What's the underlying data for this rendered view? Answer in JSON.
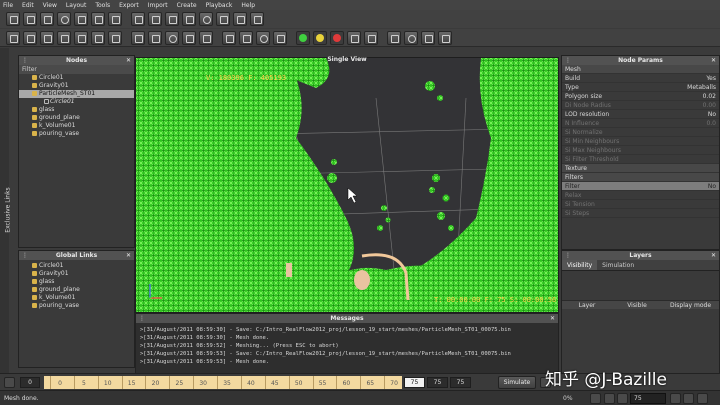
{
  "menu": [
    "File",
    "Edit",
    "View",
    "Layout",
    "Tools",
    "Export",
    "Import",
    "Create",
    "Playback",
    "Help"
  ],
  "colors": {
    "fluid": "#33dd22",
    "accent_yellow": "#ffd24a",
    "ruler": "#f3d9a0"
  },
  "nodes_panel": {
    "title": "Nodes",
    "filter_label": "Filter",
    "items": [
      {
        "label": "Circle01",
        "selected": false,
        "sub": false
      },
      {
        "label": "Gravity01",
        "selected": false,
        "sub": false
      },
      {
        "label": "ParticleMesh_ST01",
        "selected": true,
        "sub": false
      },
      {
        "label": "Circle01",
        "selected": false,
        "sub": true
      },
      {
        "label": "glass",
        "selected": false,
        "sub": false
      },
      {
        "label": "ground_plane",
        "selected": false,
        "sub": false
      },
      {
        "label": "k_Volume01",
        "selected": false,
        "sub": false
      },
      {
        "label": "pouring_vase",
        "selected": false,
        "sub": false
      }
    ]
  },
  "exclusive_links_label": "Exclusive Links",
  "global_links_panel": {
    "title": "Global Links",
    "items": [
      "Circle01",
      "Gravity01",
      "glass",
      "ground_plane",
      "k_Volume01",
      "pouring_vase"
    ]
  },
  "viewport": {
    "title": "Single View",
    "stats_top": "V: 180396 F: 405193",
    "stats_bottom": "T: 00:00:00  F: 75  S: 00:00:56"
  },
  "node_params": {
    "title": "Node Params",
    "rows": [
      {
        "label": "Mesh",
        "value": "",
        "kind": "section"
      },
      {
        "label": "Build",
        "value": "Yes",
        "kind": "normal"
      },
      {
        "label": "Type",
        "value": "Metaballs",
        "kind": "normal"
      },
      {
        "label": "Polygon size",
        "value": "0.02",
        "kind": "normal"
      },
      {
        "label": "Di Node Radius",
        "value": "0.00",
        "kind": "dim"
      },
      {
        "label": "LOD resolution",
        "value": "No",
        "kind": "normal"
      },
      {
        "label": "N Influence",
        "value": "0.0",
        "kind": "dim"
      },
      {
        "label": "Si Normalize",
        "value": "",
        "kind": "dim"
      },
      {
        "label": "Si Min Neighbours",
        "value": "",
        "kind": "dim"
      },
      {
        "label": "Si Max Neighbours",
        "value": "",
        "kind": "dim"
      },
      {
        "label": "Si Filter Threshold",
        "value": "",
        "kind": "dim"
      },
      {
        "label": "Texture",
        "value": "",
        "kind": "section"
      },
      {
        "label": "Filters",
        "value": "",
        "kind": "section"
      },
      {
        "label": "Filter",
        "value": "No",
        "kind": "filt"
      },
      {
        "label": "Relax",
        "value": "",
        "kind": "dim"
      },
      {
        "label": "Si Tension",
        "value": "",
        "kind": "dim"
      },
      {
        "label": "Si Steps",
        "value": "",
        "kind": "dim"
      }
    ]
  },
  "layers_panel": {
    "title": "Layers",
    "tabs": [
      "Visibility",
      "Simulation"
    ],
    "columns": [
      "Layer",
      "Visible",
      "Display mode"
    ]
  },
  "messages_panel": {
    "title": "Messages",
    "lines": [
      ">[31/August/2011 08:59:30] - Save: C:/Intro_RealFlow2012_proj/lesson_19_start/meshes/ParticleMesh_ST01_00075.bin",
      ">[31/August/2011 08:59:30] - Mesh done.",
      ">[31/August/2011 08:59:52] - Meshing... (Press ESC to abort)",
      ">[31/August/2011 08:59:53] - Save: C:/Intro_RealFlow2012_proj/lesson_19_start/meshes/ParticleMesh_ST01_00075.bin",
      ">[31/August/2011 08:59:53] - Mesh done."
    ]
  },
  "timeline": {
    "start_frame": "0",
    "ticks": [
      "0",
      "5",
      "10",
      "15",
      "20",
      "25",
      "30",
      "35",
      "40",
      "45",
      "50",
      "55",
      "60",
      "65",
      "70"
    ],
    "current_frame": "75",
    "end_frame_a": "75",
    "end_frame_b": "75",
    "simulate_label": "Simulate"
  },
  "status": {
    "text": "Mesh done.",
    "zoom": "0%",
    "frame_value": "75"
  },
  "watermark": "知乎 @J-Bazille"
}
